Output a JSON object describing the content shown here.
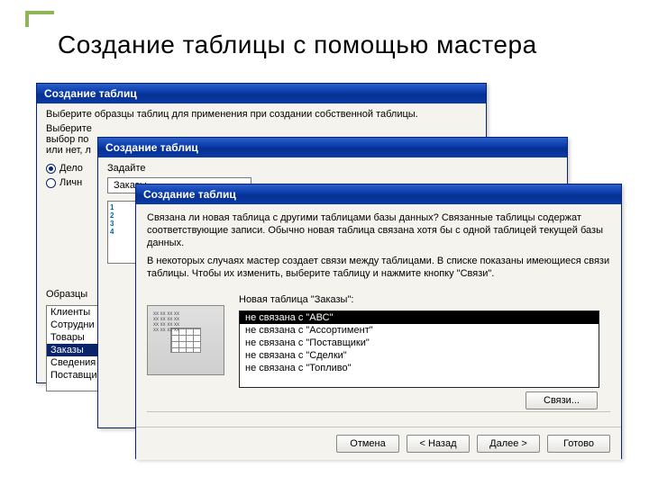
{
  "page": {
    "title": "Создание таблицы с помощью мастера"
  },
  "dlg1": {
    "title": "Создание таблиц",
    "intro": "Выберите образцы таблиц для применения при создании собственной таблицы.",
    "line2a": "Выберите",
    "line2b": "выбор по",
    "line2c": "или нет, л",
    "radio_business": "Дело",
    "radio_personal": "Личн",
    "section_label": "Образцы",
    "list": [
      "Клиенты",
      "Сотрудни",
      "Товары",
      "Заказы",
      "Сведения",
      "Поставщи"
    ],
    "selected_index": 3
  },
  "dlg2": {
    "title": "Создание таблиц",
    "prompt": "Задайте",
    "field_value": "Заказы"
  },
  "dlg3": {
    "title": "Создание таблиц",
    "para1": "Связана ли новая таблица с другими таблицами базы данных? Связанные таблицы содержат соответствующие записи. Обычно новая таблица связана хотя бы с одной таблицей текущей базы данных.",
    "para2": "В некоторых случаях мастер создает связи между таблицами. В списке показаны имеющиеся связи таблицы. Чтобы их изменить, выберите таблицу и нажмите кнопку \"Связи\".",
    "list_label": "Новая таблица \"Заказы\":",
    "rows": [
      "не связана с \"АВС\"",
      "не связана с \"Ассортимент\"",
      "не связана с \"Поставщики\"",
      "не связана с \"Сделки\"",
      "не связана с \"Топливо\""
    ],
    "selected_index": 0,
    "links_btn": "Связи...",
    "buttons": {
      "cancel": "Отмена",
      "back": "< Назад",
      "next": "Далее >",
      "finish": "Готово"
    }
  }
}
